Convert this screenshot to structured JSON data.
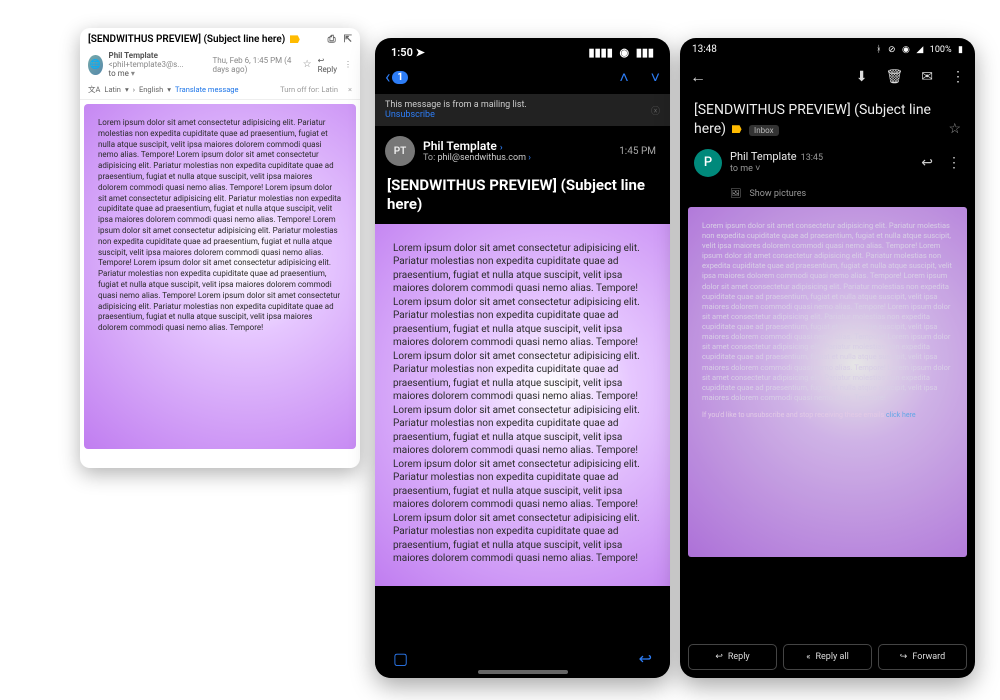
{
  "email_body": "Lorem ipsum dolor sit amet consectetur adipisicing elit. Pariatur molestias non expedita cupiditate quae ad praesentium, fugiat et nulla atque suscipit, velit ipsa maiores dolorem commodi quasi nemo alias. Tempore! Lorem ipsum dolor sit amet consectetur adipisicing elit. Pariatur molestias non expedita cupiditate quae ad praesentium, fugiat et nulla atque suscipit, velit ipsa maiores dolorem commodi quasi nemo alias. Tempore! Lorem ipsum dolor sit amet consectetur adipisicing elit. Pariatur molestias non expedita cupiditate quae ad praesentium, fugiat et nulla atque suscipit, velit ipsa maiores dolorem commodi quasi nemo alias. Tempore! Lorem ipsum dolor sit amet consectetur adipisicing elit. Pariatur molestias non expedita cupiditate quae ad praesentium, fugiat et nulla atque suscipit, velit ipsa maiores dolorem commodi quasi nemo alias. Tempore! Lorem ipsum dolor sit amet consectetur adipisicing elit. Pariatur molestias non expedita cupiditate quae ad praesentium, fugiat et nulla atque suscipit, velit ipsa maiores dolorem commodi quasi nemo alias. Tempore! Lorem ipsum dolor sit amet consectetur adipisicing elit. Pariatur molestias non expedita cupiditate quae ad praesentium, fugiat et nulla atque suscipit, velit ipsa maiores dolorem commodi quasi nemo alias. Tempore!",
  "web": {
    "subject": "[SENDWITHUS PREVIEW] (Subject line here)",
    "sender_name": "Phil Template",
    "sender_email": "<phil+template3@s...",
    "to_line": "to me",
    "timestamp": "Thu, Feb 6, 1:45 PM (4 days ago)",
    "reply": "Reply",
    "translate": {
      "icon": "文A",
      "from_lang": "Latin",
      "to_lang": "English",
      "cta": "Translate message",
      "turn_off": "Turn off for: Latin"
    }
  },
  "ios": {
    "clock": "1:50",
    "badge": "1",
    "mailing_banner": "This message is from a mailing list.",
    "unsubscribe": "Unsubscribe",
    "avatar_initials": "PT",
    "sender": "Phil Template",
    "to_label": "To:",
    "to_addr": "phil@sendwithus.com",
    "time": "1:45 PM",
    "subject": "[SENDWITHUS PREVIEW] (Subject line here)"
  },
  "android": {
    "clock": "13:48",
    "battery": "100%",
    "subject": "[SENDWITHUS PREVIEW] (Subject line here)",
    "inbox_chip": "Inbox",
    "avatar_initial": "P",
    "sender": "Phil Template",
    "time": "13:45",
    "to": "to me",
    "show_pictures": "Show pictures",
    "unsubscribe_text": "If you'd like to unsubscribe and stop receiving these emails",
    "unsubscribe_link": "click here",
    "actions": {
      "reply": "Reply",
      "reply_all": "Reply all",
      "forward": "Forward"
    }
  }
}
